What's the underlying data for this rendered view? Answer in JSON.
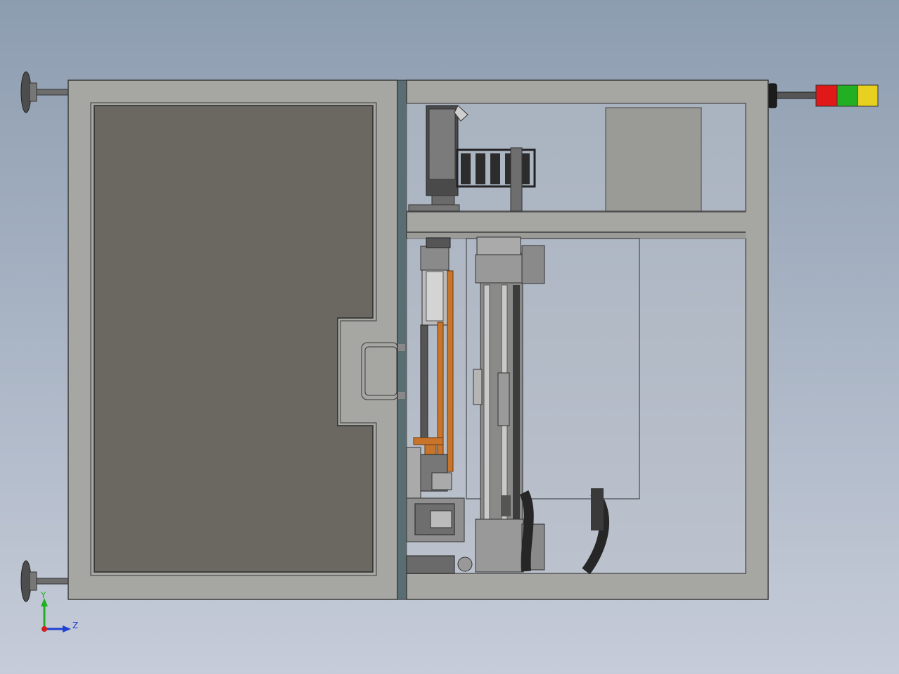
{
  "viewport": {
    "background_top": "#8d9db0",
    "background_bottom": "#c6ccd9"
  },
  "machine": {
    "frame_color": "#a6a6a3",
    "frame_edge_color": "#3a3a3a",
    "door_panel_color": "#6b6862",
    "glass_color": "#b9c0c8",
    "orange_part_color": "#c8742a",
    "dark_part_color": "#4a4a4a",
    "mid_part_color": "#8a8a88"
  },
  "signal_tower": {
    "lights": [
      {
        "name": "red",
        "color": "#e01818"
      },
      {
        "name": "green",
        "color": "#22b022"
      },
      {
        "name": "yellow",
        "color": "#e8d020"
      }
    ]
  },
  "triad": {
    "y_label": "Y",
    "z_label": "Z",
    "y_color": "#20b020",
    "z_color": "#2040d0",
    "origin_color": "#d02020"
  }
}
